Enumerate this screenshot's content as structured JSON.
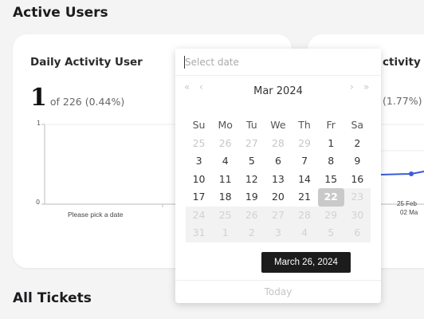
{
  "page": {
    "heading_active": "Active Users",
    "heading_tickets": "All Tickets"
  },
  "left_card": {
    "title": "Daily Activity User",
    "big_value": "1",
    "sub_text": "of 226 (0.44%)",
    "y_top": "1",
    "y_bottom": "0",
    "empty_label": "Please pick a date"
  },
  "right_card": {
    "title_fragment": "ctivity",
    "sub_fragment": "(1.77%)",
    "x_tick_1": "25 Feb",
    "x_tick_2": "02 Ma"
  },
  "datepicker": {
    "placeholder": "Select date",
    "month_year": "Mar 2024",
    "prev_year": "«",
    "prev_month": "‹",
    "next_month": "›",
    "next_year": "»",
    "weekdays": [
      "Su",
      "Mo",
      "Tu",
      "We",
      "Th",
      "Fr",
      "Sa"
    ],
    "weeks": [
      [
        [
          "25",
          "m"
        ],
        [
          "26",
          "m"
        ],
        [
          "27",
          "m"
        ],
        [
          "28",
          "m"
        ],
        [
          "29",
          "m"
        ],
        [
          "1",
          "a"
        ],
        [
          "2",
          "a"
        ]
      ],
      [
        [
          "3",
          "a"
        ],
        [
          "4",
          "a"
        ],
        [
          "5",
          "a"
        ],
        [
          "6",
          "a"
        ],
        [
          "7",
          "a"
        ],
        [
          "8",
          "a"
        ],
        [
          "9",
          "a"
        ]
      ],
      [
        [
          "10",
          "a"
        ],
        [
          "11",
          "a"
        ],
        [
          "12",
          "a"
        ],
        [
          "13",
          "a"
        ],
        [
          "14",
          "a"
        ],
        [
          "15",
          "a"
        ],
        [
          "16",
          "a"
        ]
      ],
      [
        [
          "17",
          "a"
        ],
        [
          "18",
          "a"
        ],
        [
          "19",
          "a"
        ],
        [
          "20",
          "a"
        ],
        [
          "21",
          "a"
        ],
        [
          "22",
          "t"
        ],
        [
          "23",
          "d"
        ]
      ],
      [
        [
          "24",
          "d"
        ],
        [
          "25",
          "d"
        ],
        [
          "26",
          "d"
        ],
        [
          "27",
          "d"
        ],
        [
          "28",
          "d"
        ],
        [
          "29",
          "d"
        ],
        [
          "30",
          "d"
        ]
      ],
      [
        [
          "31",
          "d"
        ],
        [
          "1",
          "d"
        ],
        [
          "2",
          "d"
        ],
        [
          "3",
          "d"
        ],
        [
          "4",
          "d"
        ],
        [
          "5",
          "d"
        ],
        [
          "6",
          "d"
        ]
      ]
    ],
    "tooltip": "March 26, 2024",
    "footer": "Today"
  },
  "colors": {
    "background": "#f4f4f5",
    "card": "#ffffff",
    "line_series": "#3b5bdb"
  }
}
